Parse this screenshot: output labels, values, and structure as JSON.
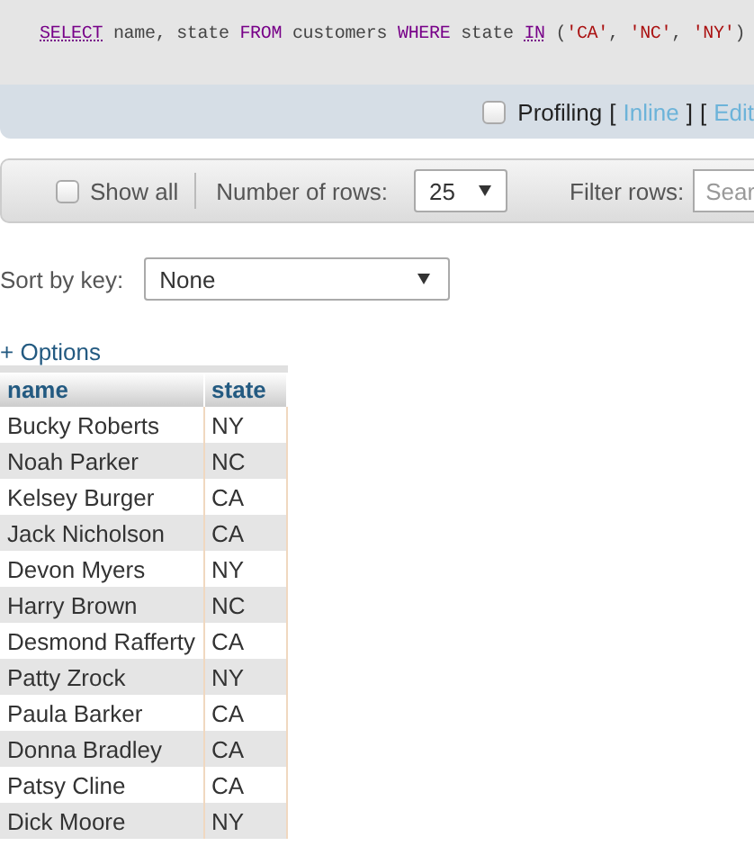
{
  "query": {
    "tokens": [
      {
        "text": "SELECT",
        "kind": "link"
      },
      {
        "text": " name, state ",
        "kind": "plain"
      },
      {
        "text": "FROM",
        "kind": "keyword"
      },
      {
        "text": " customers ",
        "kind": "plain"
      },
      {
        "text": "WHERE",
        "kind": "keyword"
      },
      {
        "text": " state ",
        "kind": "plain"
      },
      {
        "text": "IN",
        "kind": "link"
      },
      {
        "text": " (",
        "kind": "plain"
      },
      {
        "text": "'CA'",
        "kind": "string"
      },
      {
        "text": ", ",
        "kind": "plain"
      },
      {
        "text": "'NC'",
        "kind": "string"
      },
      {
        "text": ", ",
        "kind": "plain"
      },
      {
        "text": "'NY'",
        "kind": "string"
      },
      {
        "text": ")",
        "kind": "plain"
      }
    ]
  },
  "profiling": {
    "checked": false,
    "label": "Profiling",
    "open1": "[",
    "link1": "Inline",
    "close1": "]",
    "open2": "[",
    "link2": "Edit"
  },
  "toolbar": {
    "show_all": {
      "label": "Show all",
      "checked": false
    },
    "rows_label": "Number of rows:",
    "rows_value": "25",
    "filter_label": "Filter rows:",
    "filter_placeholder": "Sear"
  },
  "sort": {
    "label": "Sort by key:",
    "value": "None"
  },
  "options_link": "+ Options",
  "table": {
    "columns": [
      "name",
      "state"
    ],
    "rows": [
      [
        "Bucky Roberts",
        "NY"
      ],
      [
        "Noah Parker",
        "NC"
      ],
      [
        "Kelsey Burger",
        "CA"
      ],
      [
        "Jack Nicholson",
        "CA"
      ],
      [
        "Devon Myers",
        "NY"
      ],
      [
        "Harry Brown",
        "NC"
      ],
      [
        "Desmond Rafferty",
        "CA"
      ],
      [
        "Patty Zrock",
        "NY"
      ],
      [
        "Paula Barker",
        "CA"
      ],
      [
        "Donna Bradley",
        "CA"
      ],
      [
        "Patsy Cline",
        "CA"
      ],
      [
        "Dick Moore",
        "NY"
      ]
    ]
  }
}
